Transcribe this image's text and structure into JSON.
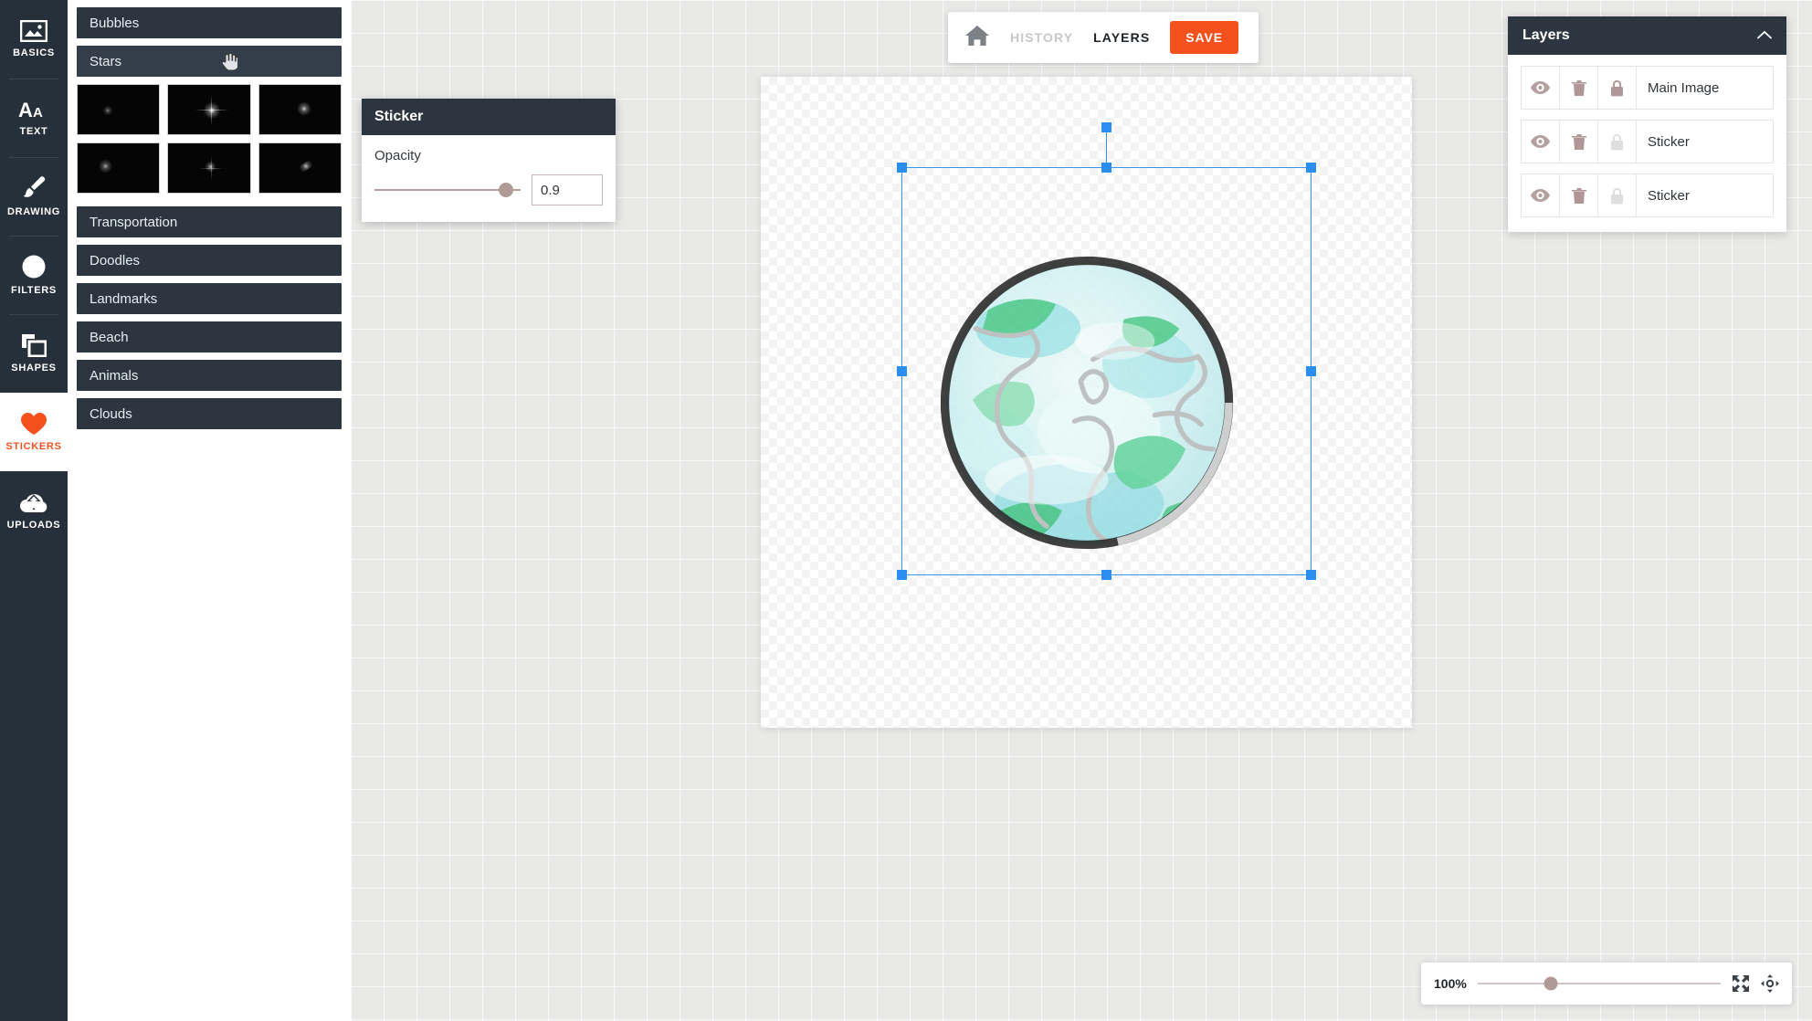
{
  "rail": {
    "items": [
      {
        "label": "BASICS",
        "icon": "image-icon",
        "active": false
      },
      {
        "label": "TEXT",
        "icon": "text-icon",
        "active": false
      },
      {
        "label": "DRAWING",
        "icon": "brush-icon",
        "active": false
      },
      {
        "label": "FILTERS",
        "icon": "contrast-icon",
        "active": false
      },
      {
        "label": "SHAPES",
        "icon": "shapes-icon",
        "active": false
      },
      {
        "label": "STICKERS",
        "icon": "heart-icon",
        "active": true
      },
      {
        "label": "UPLOADS",
        "icon": "upload-icon",
        "active": false
      }
    ],
    "active_color": "#f4511e"
  },
  "sticker_panel": {
    "categories": [
      {
        "label": "Bubbles",
        "expanded": false,
        "hovered": false
      },
      {
        "label": "Stars",
        "expanded": true,
        "hovered": true
      },
      {
        "label": "Transportation",
        "expanded": false,
        "hovered": false
      },
      {
        "label": "Doodles",
        "expanded": false,
        "hovered": false
      },
      {
        "label": "Landmarks",
        "expanded": false,
        "hovered": false
      },
      {
        "label": "Beach",
        "expanded": false,
        "hovered": false
      },
      {
        "label": "Animals",
        "expanded": false,
        "hovered": false
      },
      {
        "label": "Clouds",
        "expanded": false,
        "hovered": false
      }
    ],
    "thumbnails_count": 6,
    "cursor": "pointer-hand-cursor"
  },
  "properties": {
    "title": "Sticker",
    "opacity_label": "Opacity",
    "opacity_value": "0.9",
    "opacity_percent": 90
  },
  "toolbar": {
    "home_icon": "home-icon",
    "history_label": "HISTORY",
    "history_enabled": false,
    "layers_label": "LAYERS",
    "layers_enabled": true,
    "save_label": "SAVE",
    "save_color": "#f4511e"
  },
  "canvas": {
    "sticker_name": "earth-globe-sticker",
    "selected": true
  },
  "layers": {
    "title": "Layers",
    "collapse_icon": "chevron-up-icon",
    "rows": [
      {
        "name": "Main Image",
        "visible": true,
        "locked": true
      },
      {
        "name": "Sticker",
        "visible": true,
        "locked": false
      },
      {
        "name": "Sticker",
        "visible": true,
        "locked": false
      }
    ]
  },
  "zoombar": {
    "percent_label": "100%",
    "slider_percent": 30,
    "fit_icon": "expand-arrows-icon",
    "center_icon": "move-center-icon"
  }
}
